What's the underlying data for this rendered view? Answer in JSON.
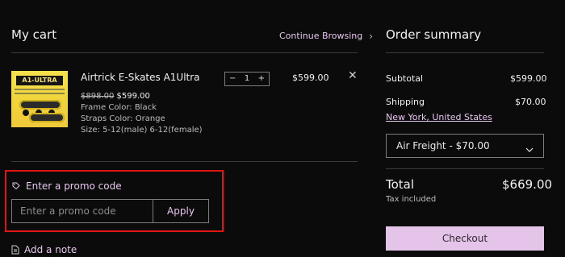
{
  "cart": {
    "title": "My cart",
    "continue_label": "Continue Browsing",
    "item": {
      "image_brand": "A1-ULTRA",
      "name": "Airtrick E-Skates A1Ultra",
      "old_price": "$898.00",
      "price": "$599.00",
      "frame_color": "Frame Color: Black",
      "straps_color": "Straps Color: Orange",
      "size": "Size: 5-12(male) 6-12(female)",
      "quantity": "1",
      "total": "$599.00"
    },
    "promo": {
      "label": "Enter a promo code",
      "placeholder": "Enter a promo code",
      "apply_label": "Apply"
    },
    "note_label": "Add a note"
  },
  "summary": {
    "title": "Order summary",
    "subtotal_label": "Subtotal",
    "subtotal_value": "$599.00",
    "shipping_label": "Shipping",
    "shipping_value": "$70.00",
    "location": "New York, United States",
    "shipping_option": "Air Freight - $70.00",
    "total_label": "Total",
    "total_value": "$669.00",
    "tax_note": "Tax included",
    "checkout_label": "Checkout"
  },
  "colors": {
    "accent": "#e6c6ee",
    "highlight_border": "#e01414",
    "background": "#0b0b0b"
  }
}
